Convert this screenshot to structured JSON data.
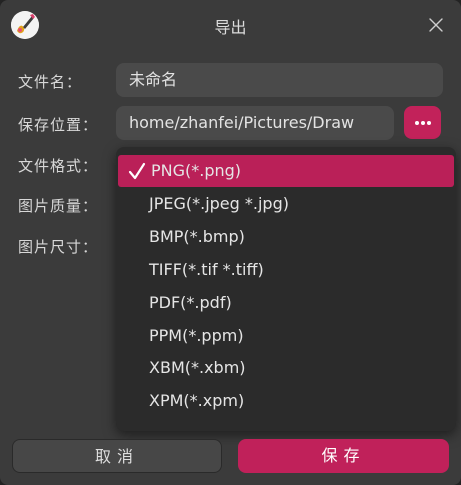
{
  "window": {
    "title": "导出",
    "app_icon": "paintbrush-app-icon",
    "close_icon": "close-icon"
  },
  "form": {
    "filename_label": "文件名：",
    "filename_value": "未命名",
    "location_label": "保存位置：",
    "location_value": "home/zhanfei/Pictures/Draw",
    "more_icon": "more-dots-icon",
    "format_label": "文件格式：",
    "quality_label": "图片质量：",
    "size_label": "图片尺寸："
  },
  "format_dropdown": {
    "selected": "PNG(*.png)",
    "options": [
      "PNG(*.png)",
      "JPEG(*.jpeg *.jpg)",
      "BMP(*.bmp)",
      "TIFF(*.tif *.tiff)",
      "PDF(*.pdf)",
      "PPM(*.ppm)",
      "XBM(*.xbm)",
      "XPM(*.xpm)"
    ]
  },
  "buttons": {
    "cancel": "取消",
    "save": "保存"
  },
  "colors": {
    "accent": "#c2225a",
    "dialog_bg": "#3b3b3b",
    "field_bg": "#4a4a4a",
    "dropdown_bg": "#2b2b2b"
  }
}
